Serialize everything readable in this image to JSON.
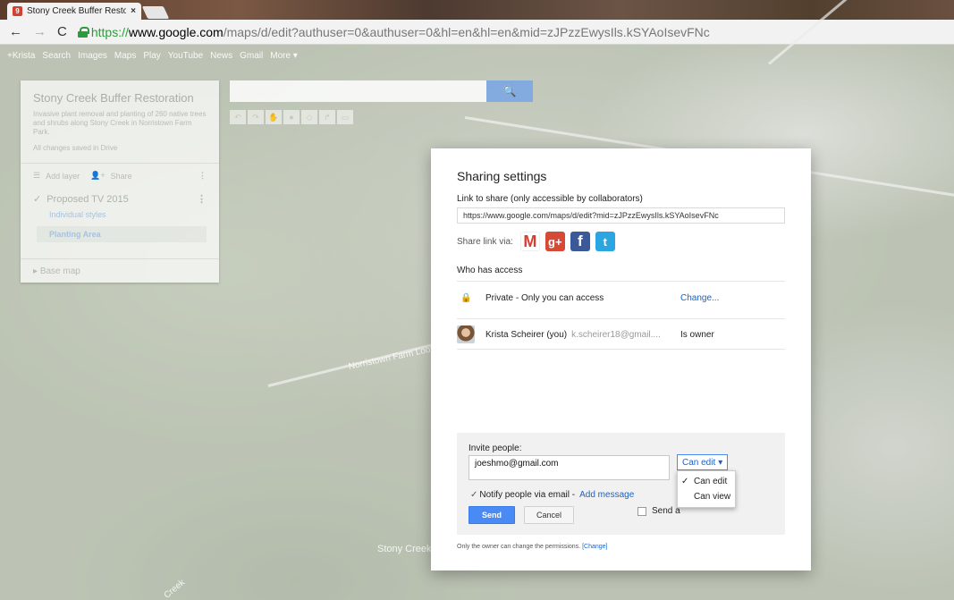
{
  "browser": {
    "tab_title": "Stony Creek Buffer Restor",
    "tab_close": "×",
    "url_scheme": "https://",
    "url_host": "www.google.com",
    "url_path": "/maps/d/edit?authuser=0&authuser=0&hl=en&hl=en&mid=zJPzzEwysIls.kSYAoIsevFNc"
  },
  "google_bar": [
    "+Krista",
    "Search",
    "Images",
    "Maps",
    "Play",
    "YouTube",
    "News",
    "Gmail",
    "More ▾"
  ],
  "map": {
    "labels": [
      "Norristown Farm Loop",
      "Stony Creek",
      "Creek"
    ]
  },
  "left_panel": {
    "title": "Stony Creek Buffer Restoration",
    "description": "Invasive plant removal and planting of 260 native trees and shrubs along Stony Creek in Norristown Farm Park.",
    "saved": "All changes saved in Drive",
    "add_layer": "Add layer",
    "share": "Share",
    "layer_name": "Proposed TV 2015",
    "individual_styles": "Individual styles",
    "planting_area": "Planting Area",
    "base_map": "Base map"
  },
  "dialog": {
    "title": "Sharing settings",
    "link_label": "Link to share (only accessible by collaborators)",
    "link_value": "https://www.google.com/maps/d/edit?mid=zJPzzEwysIls.kSYAoIsevFNc",
    "share_via_label": "Share link via:",
    "social": {
      "gmail": "M",
      "gplus": "g+",
      "facebook": "f",
      "twitter": "t"
    },
    "who_has_access": "Who has access",
    "access_rows": [
      {
        "name": "Private - Only you can access",
        "right": "Change..."
      },
      {
        "name": "Krista Scheirer (you)",
        "email": "k.scheirer18@gmail....",
        "right": "Is owner"
      }
    ],
    "invite": {
      "label": "Invite people:",
      "value": "joeshmo@gmail.com",
      "permission": "Can edit",
      "options": [
        {
          "label": "Can edit",
          "checked": true
        },
        {
          "label": "Can view",
          "checked": false
        }
      ],
      "notify": "Notify people via email -",
      "add_message": "Add message",
      "send": "Send",
      "cancel": "Cancel",
      "send_copy": "Send a"
    },
    "owner_note": "Only the owner can change the permissions.",
    "owner_note_link": "[Change]"
  },
  "colors": {
    "accent": "#4a8af4",
    "link": "#1a62c6"
  }
}
